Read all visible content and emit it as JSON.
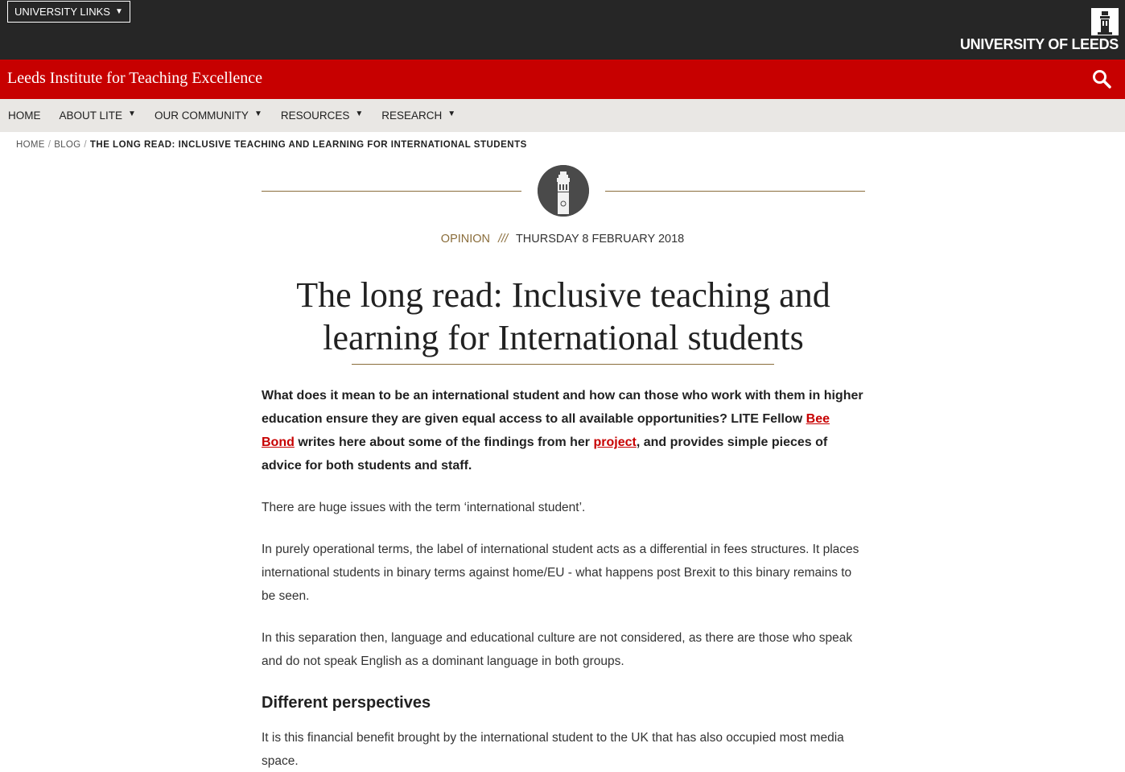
{
  "topbar": {
    "university_links_label": "UNIVERSITY LINKS",
    "logo_text": "UNIVERSITY OF LEEDS"
  },
  "site": {
    "title": "Leeds Institute for Teaching Excellence",
    "search_icon": "search-icon"
  },
  "nav": {
    "items": [
      {
        "label": "HOME",
        "has_dropdown": false
      },
      {
        "label": "ABOUT LITE",
        "has_dropdown": true
      },
      {
        "label": "OUR COMMUNITY",
        "has_dropdown": true
      },
      {
        "label": "RESOURCES",
        "has_dropdown": true
      },
      {
        "label": "RESEARCH",
        "has_dropdown": true
      }
    ]
  },
  "breadcrumb": {
    "home": "HOME",
    "blog": "BLOG",
    "current": "THE LONG READ: INCLUSIVE TEACHING AND LEARNING FOR INTERNATIONAL STUDENTS"
  },
  "article": {
    "category": "OPINION",
    "separator": "///",
    "date": "THURSDAY 8 FEBRUARY 2018",
    "title": "The long read: Inclusive teaching and learning for International students",
    "lede": {
      "part1": "What does it mean to be an international student and how can those who work with them in higher education ensure they are given equal access to all available opportunities? LITE Fellow ",
      "link1": "Bee Bond",
      "part2": " writes here about some of the findings from her ",
      "link2": "project",
      "part3": ", and provides simple pieces of advice for both students and staff."
    },
    "paragraphs": [
      "There are huge issues with the term ‘international student’.",
      "In purely operational terms, the label of international student acts as a differential in fees structures. It places international students in binary terms against home/EU - what happens post Brexit to this binary remains to be seen.",
      "In this separation then, language and educational culture are not considered, as there are those who speak and do not speak English as a dominant language in both groups."
    ],
    "subheading": "Different perspectives",
    "paragraph_after": "It is this financial benefit brought by the international student to the UK that has also occupied most media space."
  },
  "colors": {
    "topbar": "#262626",
    "brand_red": "#c70000",
    "nav_bg": "#e9e7e4",
    "accent_gold": "#8a6d3b"
  }
}
